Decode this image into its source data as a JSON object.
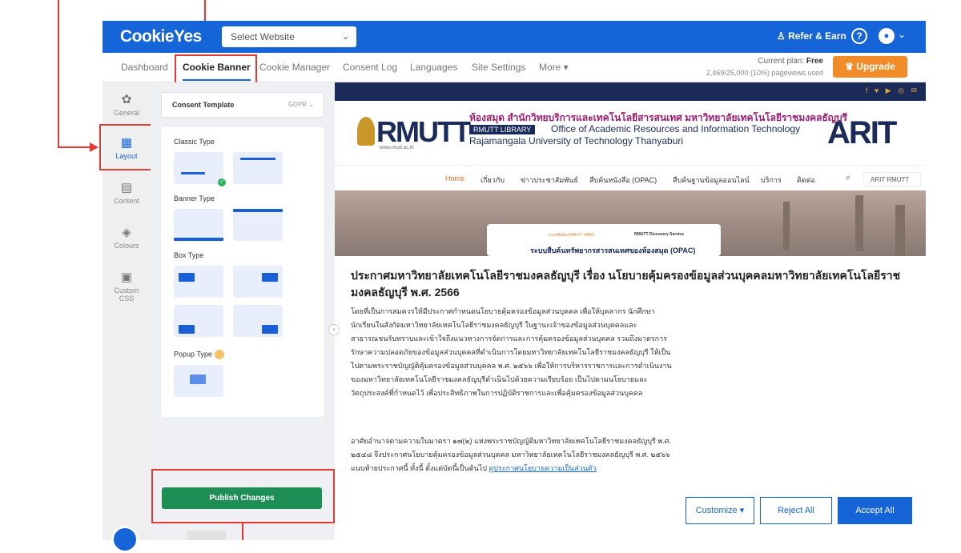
{
  "app": {
    "logo": "CookieYes",
    "site_select_placeholder": "Select Website"
  },
  "topbar": {
    "refer_label": "Refer & Earn",
    "help_icon": "question-circle-icon",
    "user_icon": "user-avatar-icon"
  },
  "nav": {
    "tabs": [
      {
        "label": "Dashboard"
      },
      {
        "label": "Cookie Banner"
      },
      {
        "label": "Cookie Manager"
      },
      {
        "label": "Consent Log"
      },
      {
        "label": "Languages"
      },
      {
        "label": "Site Settings"
      },
      {
        "label": "More ▾"
      }
    ],
    "active_tab": "Cookie Banner",
    "plan_label": "Current plan:",
    "plan_name": "Free",
    "pageviews": "2,469/25,000 (10%) pageviews used",
    "upgrade_label": "Upgrade"
  },
  "sidebar": {
    "items": [
      {
        "label": "General",
        "icon": "gear-icon"
      },
      {
        "label": "Layout",
        "icon": "grid-icon"
      },
      {
        "label": "Content",
        "icon": "document-icon"
      },
      {
        "label": "Colours",
        "icon": "paint-bucket-icon"
      },
      {
        "label": "Custom CSS",
        "icon": "css-file-icon"
      }
    ],
    "active": "Layout"
  },
  "panel": {
    "template_label": "Consent Template",
    "template_value": "GDPR",
    "classic_label": "Classic Type",
    "banner_label": "Banner Type",
    "box_label": "Box Type",
    "popup_label": "Popup Type",
    "publish_label": "Publish Changes"
  },
  "preview": {
    "socials": "f ♥ ▶ ◎ ✉",
    "logo_text": "RMUTT",
    "logo_url": "www.rmutt.ac.th",
    "header_thai": "ห้องสมุด สำนักวิทยบริการและเทคโนโลยีสารสนเทศ มหาวิทยาลัยเทคโนโลยีราชมงคลธัญบุรี",
    "library_tag": "RMUTT LIBRARY",
    "office_en": "Office of Academic Resources and Information Technology",
    "university_en": "Rajamangala University of Technology Thanyaburi",
    "arit_logo": "ARIT",
    "menu": [
      "Home",
      "เกี่ยวกับ",
      "ข่าวประชาสัมพันธ์",
      "สืบค้นหนังสือ (OPAC)",
      "สืบค้นฐานข้อมูลออนไลน์",
      "บริการ",
      "ติดต่อ"
    ],
    "search_label": "ARIT RMUTT",
    "opac_pill": "ระบบสืบค้น RMUTT OPAC",
    "discovery_label": "RMUTT Discovery Service",
    "opac_subtitle": "ระบบสืบค้นทรัพยากรสารสนเทศของห้องสมุด (OPAC)"
  },
  "notice": {
    "title": "ประกาศมหาวิทยาลัยเทคโนโลยีราชมงคลธัญบุรี เรื่อง นโยบายคุ้มครองข้อมูลส่วนบุคคลมหาวิทยาลัยเทคโนโลยีราชมงคลธัญบุรี พ.ศ. 2566",
    "body1": "โดยที่เป็นการสมควรให้มีประกาศกำหนดนโยบายคุ้มครองข้อมูลส่วนบุคคล เพื่อให้บุคลากร นักศึกษา นักเรียนในสังกัดมหาวิทยาลัยเทคโนโลยีราชมงคลธัญบุรี ในฐานะเจ้าของข้อมูลส่วนบุคคลและสาธารณชนรับทราบและเข้าใจถึงแนวทางการจัดการและการคุ้มครองข้อมูลส่วนบุคคล รวมถึงมาตรการรักษาความปลอดภัยของข้อมูลส่วนบุคคลที่ดำเนินการโดยมหาวิทยาลัยเทคโนโลยีราชมงคลธัญบุรี ให้เป็นไปตามพระราชบัญญัติคุ้มครองข้อมูลส่วนบุคคล พ.ศ. ๒๕๖๖ เพื่อให้การบริหารราชการและการดำเนินงานของมหาวิทยาลัยเทคโนโลยีราชมงคลธัญบุรีดำเนินไปด้วยความเรียบร้อย เป็นไปตามนโยบายและวัตถุประสงค์ที่กำหนดไว้ เพื่อประสิทธิภาพในการปฏิบัติราชการและเพื่อคุ้มครองข้อมูลส่วนบุคคล",
    "body2": "อาศัยอำนาจตามความในมาตรา ๑๗(๒) แห่งพระราชบัญญัติมหาวิทยาลัยเทคโนโลยีราชมงคลธัญบุรี พ.ศ. ๒๕๔๘ จึงประกาศนโยบายคุ้มครองข้อมูลส่วนบุคคล มหาวิทยาลัยเทคโนโลยีราชมงคลธัญบุรี พ.ศ. ๒๕๖๖ แนบท้ายประกาศนี้ ทั้งนี้ ตั้งแต่บัดนี้เป็นต้นไป",
    "link": "ดูประกาศนโยบายความเป็นส่วนตัว",
    "customize_label": "Customize ▾",
    "reject_label": "Reject All",
    "accept_label": "Accept All"
  },
  "colors": {
    "brand": "#1565d8",
    "upgrade": "#f28c28",
    "publish": "#1d8f55",
    "annotation": "#e53935"
  }
}
